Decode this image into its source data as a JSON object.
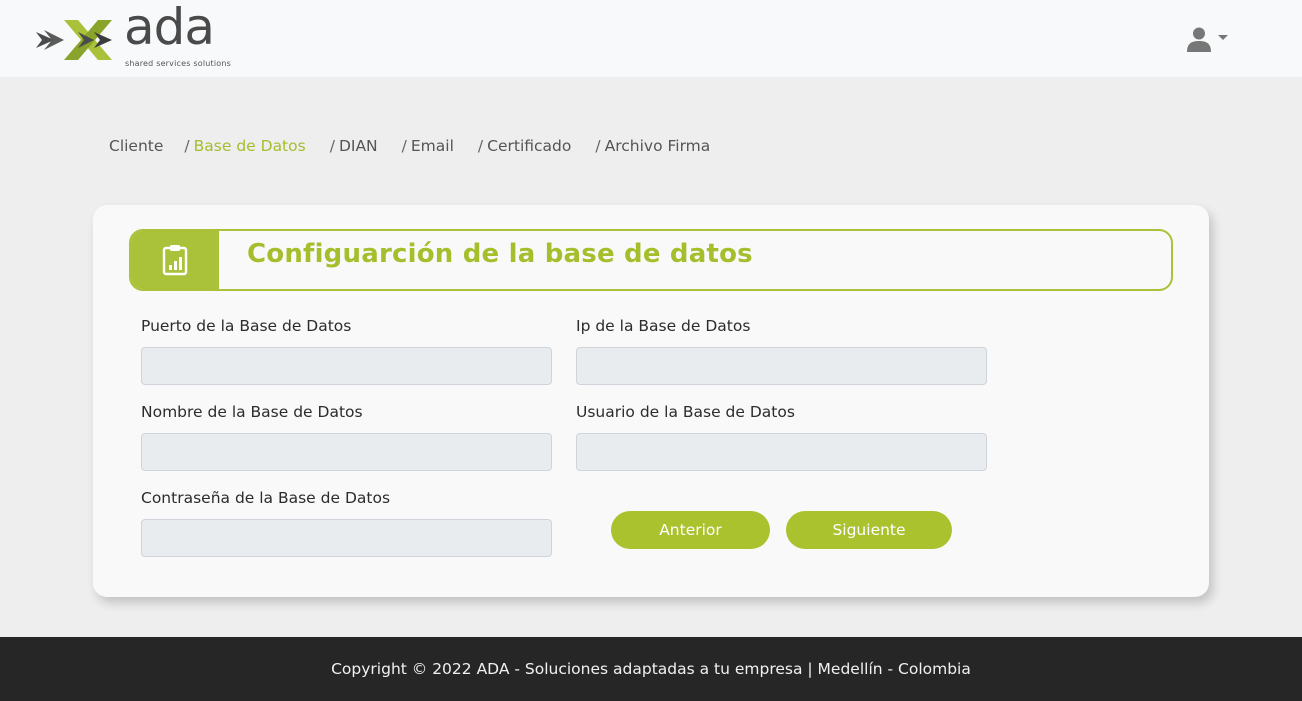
{
  "header": {
    "logo_word": "ada",
    "logo_tagline": "shared services solutions",
    "colors": {
      "brand_green": "#a9c23a",
      "logo_gray": "#4a4a4a"
    }
  },
  "breadcrumb": {
    "separator": "/",
    "items": [
      {
        "label": "Cliente",
        "active": false
      },
      {
        "label": "Base de Datos",
        "active": true
      },
      {
        "label": "DIAN",
        "active": false
      },
      {
        "label": "Email",
        "active": false
      },
      {
        "label": "Certificado",
        "active": false
      },
      {
        "label": "Archivo Firma",
        "active": false
      }
    ]
  },
  "section": {
    "title": "Configuarción de la base de datos",
    "icon": "clipboard-chart-icon"
  },
  "form": {
    "puerto": {
      "label": "Puerto de la Base de Datos",
      "value": "",
      "placeholder": ""
    },
    "ip": {
      "label": "Ip de la Base de Datos",
      "value": "",
      "placeholder": ""
    },
    "nombre": {
      "label": "Nombre de la Base de Datos",
      "value": "",
      "placeholder": ""
    },
    "usuario": {
      "label": "Usuario de la Base de Datos",
      "value": "",
      "placeholder": ""
    },
    "contrasena": {
      "label": "Contraseña de la Base de Datos",
      "value": "",
      "placeholder": ""
    },
    "anterior_label": "Anterior",
    "siguiente_label": "Siguiente"
  },
  "footer": {
    "text": "Copyright © 2022 ADA - Soluciones adaptadas a tu empresa | Medellín - Colombia"
  }
}
